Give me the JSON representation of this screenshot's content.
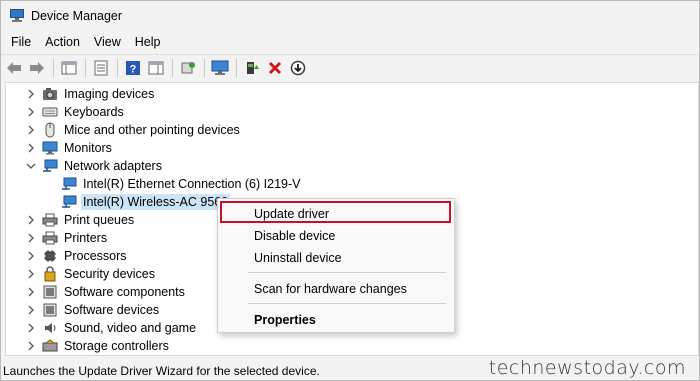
{
  "window": {
    "title": "Device Manager"
  },
  "menubar": {
    "items": [
      "File",
      "Action",
      "View",
      "Help"
    ]
  },
  "toolbar": {
    "buttons": [
      "back-icon",
      "forward-icon",
      "properties-icon",
      "help-icon",
      "show-hide-icon",
      "scan-icon",
      "monitor-icon",
      "update-driver-icon",
      "uninstall-icon",
      "disable-icon"
    ]
  },
  "tree": {
    "items": [
      {
        "label": "Imaging devices",
        "icon": "camera-icon"
      },
      {
        "label": "Keyboards",
        "icon": "keyboard-icon"
      },
      {
        "label": "Mice and other pointing devices",
        "icon": "mouse-icon"
      },
      {
        "label": "Monitors",
        "icon": "monitor-icon"
      },
      {
        "label": "Network adapters",
        "icon": "network-adapter-icon",
        "expanded": true
      },
      {
        "label": "Intel(R) Ethernet Connection (6) I219-V",
        "icon": "network-adapter-icon",
        "child": true
      },
      {
        "label": "Intel(R) Wireless-AC 9560",
        "icon": "network-adapter-icon",
        "child": true,
        "selected": true
      },
      {
        "label": "Print queues",
        "icon": "printer-icon"
      },
      {
        "label": "Printers",
        "icon": "printer-icon"
      },
      {
        "label": "Processors",
        "icon": "processor-icon"
      },
      {
        "label": "Security devices",
        "icon": "security-icon"
      },
      {
        "label": "Software components",
        "icon": "software-icon"
      },
      {
        "label": "Software devices",
        "icon": "software-icon"
      },
      {
        "label": "Sound, video and game",
        "icon": "speaker-icon"
      },
      {
        "label": "Storage controllers",
        "icon": "storage-icon"
      }
    ]
  },
  "context_menu": {
    "items": [
      "Update driver",
      "Disable device",
      "Uninstall device",
      "Scan for hardware changes",
      "Properties"
    ]
  },
  "statusbar": {
    "text": "Launches the Update Driver Wizard for the selected device."
  },
  "watermark": "technewstoday.com",
  "colors": {
    "highlight": "#c8102e",
    "selection": "#cce4f7",
    "accent": "#2f78c8"
  }
}
